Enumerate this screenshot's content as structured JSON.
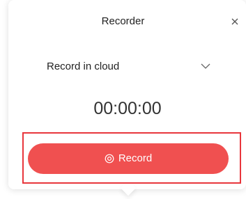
{
  "window": {
    "title": "Recorder",
    "close_icon": "close-icon"
  },
  "mode": {
    "selected": "Record in cloud",
    "dropdown_icon": "chevron-down-icon"
  },
  "timer": {
    "value": "00:00:00"
  },
  "record_button": {
    "label": "Record",
    "icon": "record-icon",
    "color": "#f05050",
    "highlight_color": "#e8363c"
  }
}
